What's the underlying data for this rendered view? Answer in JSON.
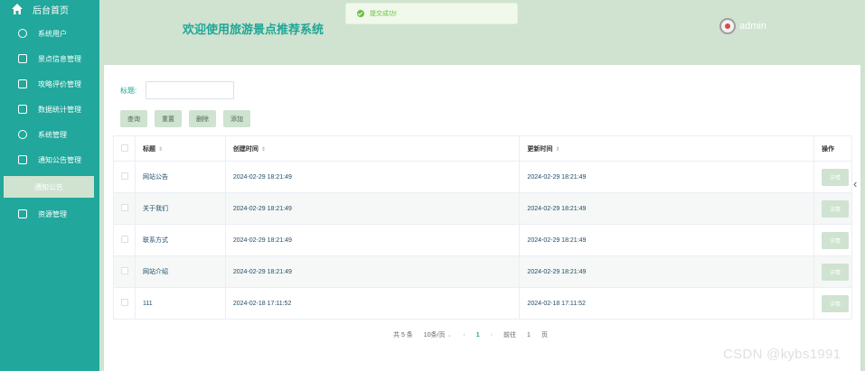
{
  "sidebar": {
    "home_label": "后台首页",
    "items": [
      {
        "label": "系统用户",
        "icon": "cloud-icon"
      },
      {
        "label": "景点信息管理",
        "icon": "edit-icon"
      },
      {
        "label": "攻略评价管理",
        "icon": "message-icon"
      },
      {
        "label": "数据统计管理",
        "icon": "edit-icon"
      },
      {
        "label": "系统管理",
        "icon": "cloud-icon"
      },
      {
        "label": "通知公告管理",
        "icon": "message-icon"
      }
    ],
    "sub_item": "通知公告",
    "after_item": {
      "label": "资源管理",
      "icon": "download-icon"
    }
  },
  "header": {
    "title": "欢迎使用旅游景点推荐系统",
    "username": "admin"
  },
  "toast": {
    "message": "提交成功!"
  },
  "search": {
    "label": "标题:",
    "value": "",
    "placeholder": ""
  },
  "buttons": {
    "query": "查询",
    "reset": "重置",
    "delete": "删除",
    "add": "添加"
  },
  "table": {
    "headers": {
      "title": "标题",
      "created": "创建时间",
      "updated": "更新时间",
      "ops": "操作"
    },
    "detail_label": "详情",
    "rows": [
      {
        "title": "网站公告",
        "created": "2024-02-29 18:21:49",
        "updated": "2024-02-29 18:21:49"
      },
      {
        "title": "关于我们",
        "created": "2024-02-29 18:21:49",
        "updated": "2024-02-29 18:21:49"
      },
      {
        "title": "联系方式",
        "created": "2024-02-29 18:21:49",
        "updated": "2024-02-29 18:21:49"
      },
      {
        "title": "网站介绍",
        "created": "2024-02-29 18:21:49",
        "updated": "2024-02-29 18:21:49"
      },
      {
        "title": "111",
        "created": "2024-02-18 17:11:52",
        "updated": "2024-02-18 17:11:52"
      }
    ]
  },
  "pagination": {
    "total": "共 5 条",
    "page_size": "10条/页",
    "current": "1",
    "goto_label": "前往",
    "goto_value": "1",
    "page_unit": "页"
  },
  "watermark": "CSDN @kybs1991",
  "colors": {
    "sidebar": "#21a79b",
    "header": "#cfe3d0",
    "accent": "#1ea697"
  }
}
